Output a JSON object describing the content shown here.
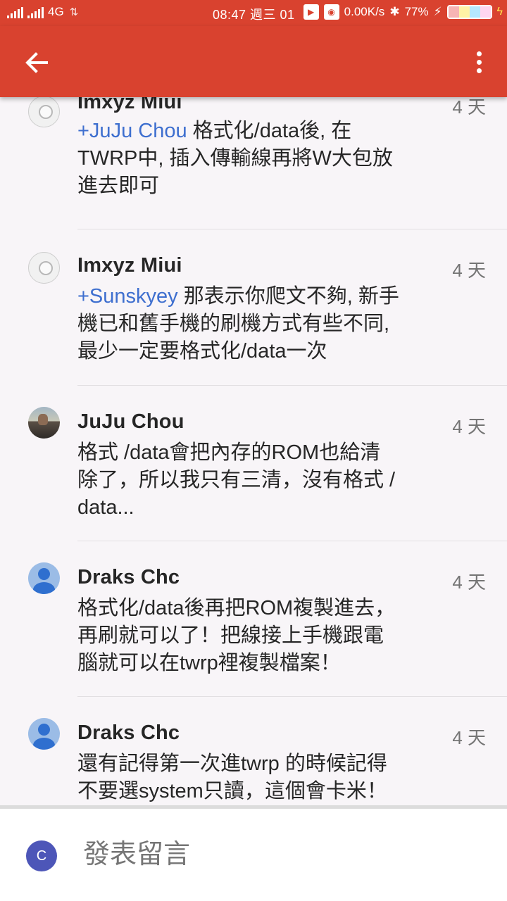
{
  "status_bar": {
    "network": "4G",
    "time_date": "08:47 週三 01",
    "net_speed": "0.00K/s",
    "battery": "77%"
  },
  "app_bar": {
    "back_icon": "arrow-left-icon",
    "menu_icon": "more-vert-icon"
  },
  "comments": [
    {
      "author": "Imxyz Miui",
      "time": "4 天",
      "avatar": "device",
      "mention": "+JuJu Chou",
      "lines": [
        " 格式化/data後, 在",
        "TWRP中, 插入傳輸線再將W大包放",
        "進去即可"
      ]
    },
    {
      "author": "Imxyz Miui",
      "time": "4 天",
      "avatar": "device",
      "mention": "+Sunskyey",
      "lines": [
        " 那表示你爬文不夠, 新手",
        "機已和舊手機的刷機方式有些不同,",
        "最少一定要格式化/data一次"
      ]
    },
    {
      "author": "JuJu Chou",
      "time": "4 天",
      "avatar": "photo",
      "mention": "",
      "lines": [
        "格式 /data會把內存的ROM也給清",
        "除了，所以我只有三清，沒有格式 /",
        "data..."
      ]
    },
    {
      "author": "Draks Chc",
      "time": "4 天",
      "avatar": "person",
      "mention": "",
      "lines": [
        "格式化/data後再把ROM複製進去，",
        "再刷就可以了！把線接上手機跟電",
        "腦就可以在twrp裡複製檔案！"
      ]
    },
    {
      "author": "Draks Chc",
      "time": "4 天",
      "avatar": "person",
      "mention": "",
      "lines": [
        "還有記得第一次進twrp 的時候記得",
        "不要選system只讀，這個會卡米！"
      ]
    }
  ],
  "composer": {
    "user_initial": "C",
    "placeholder": "發表留言"
  }
}
